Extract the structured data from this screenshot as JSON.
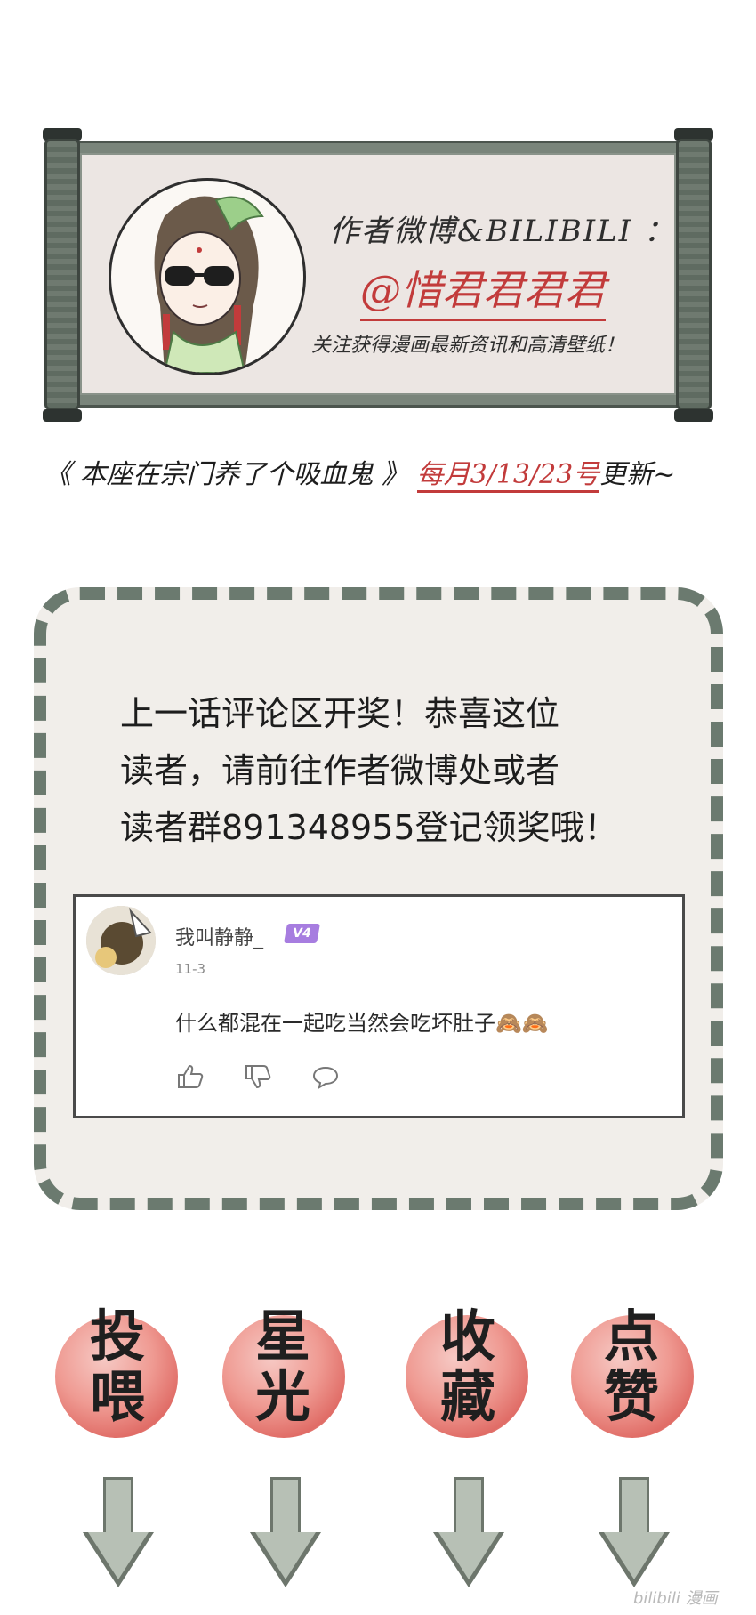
{
  "banner": {
    "heading": "作者微博&BILIBILI ：",
    "handle": "@惜君君君君",
    "subtext": "关注获得漫画最新资讯和高清壁纸！"
  },
  "update_line": {
    "title": "《 本座在宗门养了个吸血鬼 》",
    "schedule": "每月3/13/23号",
    "suffix": "更新~"
  },
  "announcement": {
    "line1": "上一话评论区开奖！恭喜这位",
    "line2": "读者，请前往作者微博处或者",
    "line3": "读者群891348955登记领奖哦！"
  },
  "comment": {
    "username": "我叫静静_",
    "level": "V4",
    "date": "11-3",
    "text": "什么都混在一起吃当然会吃坏肚子",
    "emoji": "🙈🙈"
  },
  "actions": [
    {
      "label": "投喂"
    },
    {
      "label": "星光"
    },
    {
      "label": "收藏"
    },
    {
      "label": "点赞"
    }
  ],
  "watermark": "bilibili 漫画",
  "colors": {
    "accent_red": "#c23b3b",
    "scroll_green": "#6f7a70",
    "level_purple": "#a77de0"
  }
}
